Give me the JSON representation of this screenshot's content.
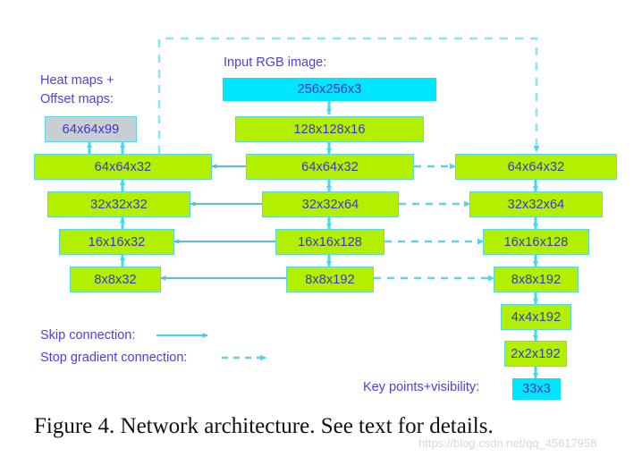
{
  "figure": {
    "caption": "Figure 4. Network architecture. See text for details.",
    "watermark": "https://blog.csdn.net/qq_45617958"
  },
  "labels": {
    "heat_maps_line1": "Heat maps +",
    "heat_maps_line2": "Offset maps:",
    "input_image": "Input RGB image:",
    "key_points": "Key points+visibility:"
  },
  "legend": {
    "skip": "Skip connection:",
    "stop_gradient": "Stop gradient connection:"
  },
  "colors": {
    "green_block": "#b2f000",
    "cyan_block": "#00e6ff",
    "gray_block": "#c9ced3",
    "border": "#5ad8e8",
    "text_blue": "#3b35c9",
    "label_blue": "#4a3ff0",
    "skip_arrow": "#4fc3d9",
    "stop_arrow": "#49d8f0"
  },
  "blocks": {
    "output_heatmap": "64x64x99",
    "input_rgb": "256x256x3",
    "keypoints": "33x3",
    "encoder": [
      "128x128x16",
      "64x64x32",
      "32x32x64",
      "16x16x128",
      "8x8x192"
    ],
    "decoder": [
      "64x64x32",
      "32x32x32",
      "16x16x32",
      "8x8x32"
    ],
    "right_branch": [
      "64x64x32",
      "32x32x64",
      "16x16x128",
      "8x8x192",
      "4x4x192",
      "2x2x192"
    ]
  },
  "chart_data": {
    "type": "diagram",
    "title": "Network architecture",
    "columns": {
      "left_decoder": [
        "64x64x99",
        "64x64x32",
        "32x32x32",
        "16x16x32",
        "8x8x32"
      ],
      "center_encoder": [
        "256x256x3",
        "128x128x16",
        "64x64x32",
        "32x32x64",
        "16x16x128",
        "8x8x192"
      ],
      "right_branch": [
        "64x64x32",
        "32x32x64",
        "16x16x128",
        "8x8x192",
        "4x4x192",
        "2x2x192",
        "33x3"
      ]
    },
    "edge_types": [
      "skip connection (solid arrow)",
      "stop gradient connection (dashed arrow)"
    ]
  }
}
